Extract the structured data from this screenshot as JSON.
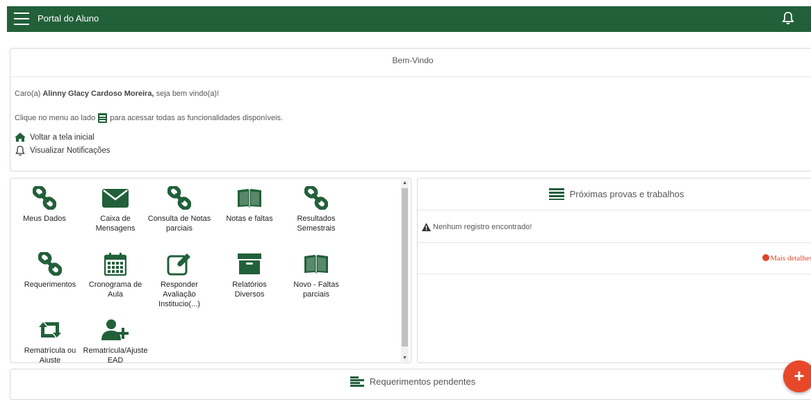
{
  "header": {
    "title": "Portal do Aluno",
    "menu_icon": "hamburger-icon",
    "bell_icon": "bell-icon",
    "bar_color": "#22603a"
  },
  "welcome": {
    "title": "Bem-Vindo",
    "greeting_prefix": "Caro(a)",
    "student_name": "Alinny Glacy Cardoso Moreira,",
    "greeting_suffix": "seja bem vindo(a)!",
    "hint_before": "Clique no menu ao lado",
    "hint_after": "para acessar todas as funcionalidades disponíveis.",
    "links": [
      {
        "label": "Voltar a tela inicial",
        "icon": "home-icon"
      },
      {
        "label": "Visualizar Notificações",
        "icon": "bell-icon"
      }
    ]
  },
  "apps": [
    {
      "label": "Meus Dados",
      "icon": "link-icon"
    },
    {
      "label": "Caixa de Mensagens",
      "icon": "envelope-icon"
    },
    {
      "label": "Consulta de Notas parciais",
      "icon": "link-icon"
    },
    {
      "label": "Notas e faltas",
      "icon": "book-icon"
    },
    {
      "label": "Resultados Semestrais",
      "icon": "link-icon"
    },
    {
      "label": "Requerimentos",
      "icon": "link-icon"
    },
    {
      "label": "Cronograma de Aula",
      "icon": "calendar-icon"
    },
    {
      "label": "Responder Avaliação Institucio(...)",
      "icon": "edit-icon"
    },
    {
      "label": "Relatórios Diversos",
      "icon": "archive-icon"
    },
    {
      "label": "Novo - Faltas parciais",
      "icon": "book-icon"
    },
    {
      "label": "Rematrícula ou Ajuste",
      "icon": "retweet-icon"
    },
    {
      "label": "Rematrícula/Ajuste EAD",
      "icon": "user-plus-icon"
    }
  ],
  "exams": {
    "title": "Próximas provas e trabalhos",
    "empty_message": "Nenhum registro encontrado!",
    "more_link": "Mais detalhes",
    "more_color": "#e0462a"
  },
  "pending": {
    "title": "Requerimentos pendentes"
  },
  "fab": {
    "label": "+",
    "color": "#e8482a"
  }
}
